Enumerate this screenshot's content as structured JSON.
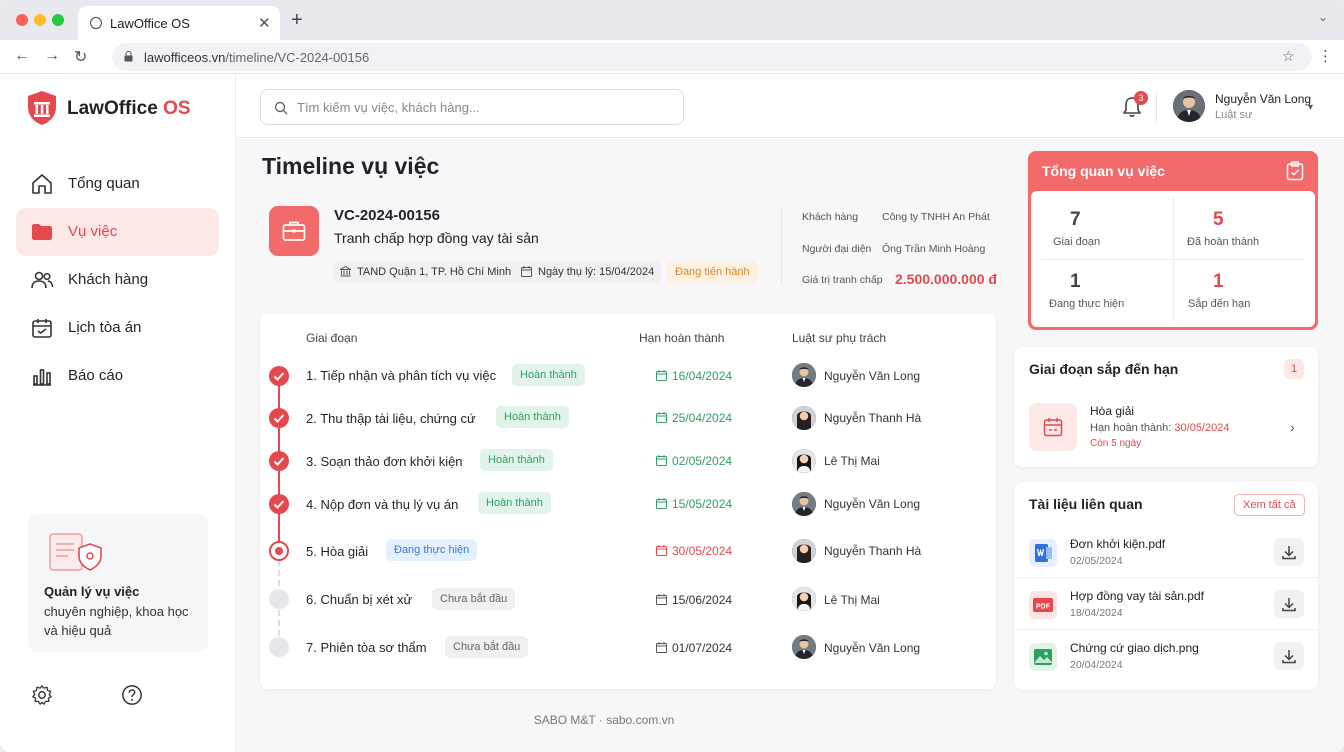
{
  "browser": {
    "tab_title": "LawOffice OS",
    "url_domain": "lawofficeos.vn",
    "url_path": "/timeline/VC-2024-00156"
  },
  "brand": {
    "name_main": "LawOffice",
    "name_accent": " OS",
    "accent": "#e5484d"
  },
  "sidebar": {
    "items": [
      {
        "label": "Tổng quan",
        "icon": "home-icon"
      },
      {
        "label": "Vụ việc",
        "icon": "folder-icon",
        "active": true
      },
      {
        "label": "Khách hàng",
        "icon": "users-icon"
      },
      {
        "label": "Lịch tòa án",
        "icon": "calendar-icon"
      },
      {
        "label": "Báo cáo",
        "icon": "bar-chart-icon"
      }
    ],
    "promo_title": "Quản lý vụ việc",
    "promo_text": "chuyên nghiệp, khoa học và hiệu quả"
  },
  "topbar": {
    "search_placeholder": "Tìm kiếm vụ việc, khách hàng...",
    "notification_count": "3",
    "user_name": "Nguyễn Văn Long",
    "user_role": "Luật sư"
  },
  "page": {
    "title": "Timeline vụ việc"
  },
  "case": {
    "id": "VC-2024-00156",
    "name": "Tranh chấp hợp đồng vay tài sản",
    "court": "TAND Quận 1, TP. Hồ Chí Minh",
    "accepted_date": "Ngày thụ lý: 15/04/2024",
    "status": "Đang tiến hành",
    "client_label": "Khách hàng",
    "client_value": "Công ty TNHH An Phát",
    "rep_label": "Người đại diện",
    "rep_value": "Ông Trần Minh Hoàng",
    "amount_label": "Giá trị tranh chấp",
    "amount_value": "2.500.000.000 đ"
  },
  "timeline": {
    "headers": {
      "stage": "Giai đoạn",
      "deadline": "Hạn hoàn thành",
      "lawyer": "Luật sư phụ trách"
    },
    "steps": [
      {
        "name": "1. Tiếp nhận và phân tích vụ việc",
        "status": "Hoàn thành",
        "state": "done",
        "date": "16/04/2024",
        "lawyer": "Nguyễn Văn Long"
      },
      {
        "name": "2. Thu thập tài liệu, chứng cứ",
        "status": "Hoàn thành",
        "state": "done",
        "date": "25/04/2024",
        "lawyer": "Nguyễn Thanh Hà"
      },
      {
        "name": "3. Soạn thảo đơn khởi kiện",
        "status": "Hoàn thành",
        "state": "done",
        "date": "02/05/2024",
        "lawyer": "Lê Thị Mai"
      },
      {
        "name": "4. Nộp đơn và thụ lý vụ án",
        "status": "Hoàn thành",
        "state": "done",
        "date": "15/05/2024",
        "lawyer": "Nguyễn Văn Long"
      },
      {
        "name": "5. Hòa giải",
        "status": "Đang thực hiện",
        "state": "current",
        "date": "30/05/2024",
        "lawyer": "Nguyễn Thanh Hà"
      },
      {
        "name": "6. Chuẩn bị xét xử",
        "status": "Chưa bắt đầu",
        "state": "todo",
        "date": "15/06/2024",
        "lawyer": "Lê Thị Mai"
      },
      {
        "name": "7. Phiên tòa sơ thẩm",
        "status": "Chưa bắt đầu",
        "state": "todo",
        "date": "01/07/2024",
        "lawyer": "Nguyễn Văn Long"
      }
    ]
  },
  "overview": {
    "title": "Tổng quan vụ việc",
    "stats": [
      {
        "value": "7",
        "label": "Giai đoạn",
        "color": "#444444"
      },
      {
        "value": "5",
        "label": "Đã hoàn thành",
        "color": "#e5484d"
      },
      {
        "value": "1",
        "label": "Đang thực hiện",
        "color": "#444444"
      },
      {
        "value": "1",
        "label": "Sắp đến hạn",
        "color": "#e5484d"
      }
    ]
  },
  "deadline": {
    "title": "Giai đoạn sắp đến hạn",
    "count": "1",
    "item_name": "Hòa giải",
    "due_label": "Hạn hoàn thành: ",
    "due_date": "30/05/2024",
    "remaining": "Còn 5 ngày"
  },
  "documents": {
    "title": "Tài liệu liên quan",
    "view_all": "Xem tất cả",
    "items": [
      {
        "name": "Đơn khởi kiện.pdf",
        "date": "02/05/2024",
        "icon": "word-file-icon"
      },
      {
        "name": "Hợp đồng vay tài sản.pdf",
        "date": "18/04/2024",
        "icon": "pdf-file-icon"
      },
      {
        "name": "Chứng cứ giao dịch.png",
        "date": "20/04/2024",
        "icon": "image-file-icon"
      }
    ]
  },
  "footer": {
    "text": "SABO M&T · sabo.com.vn"
  }
}
